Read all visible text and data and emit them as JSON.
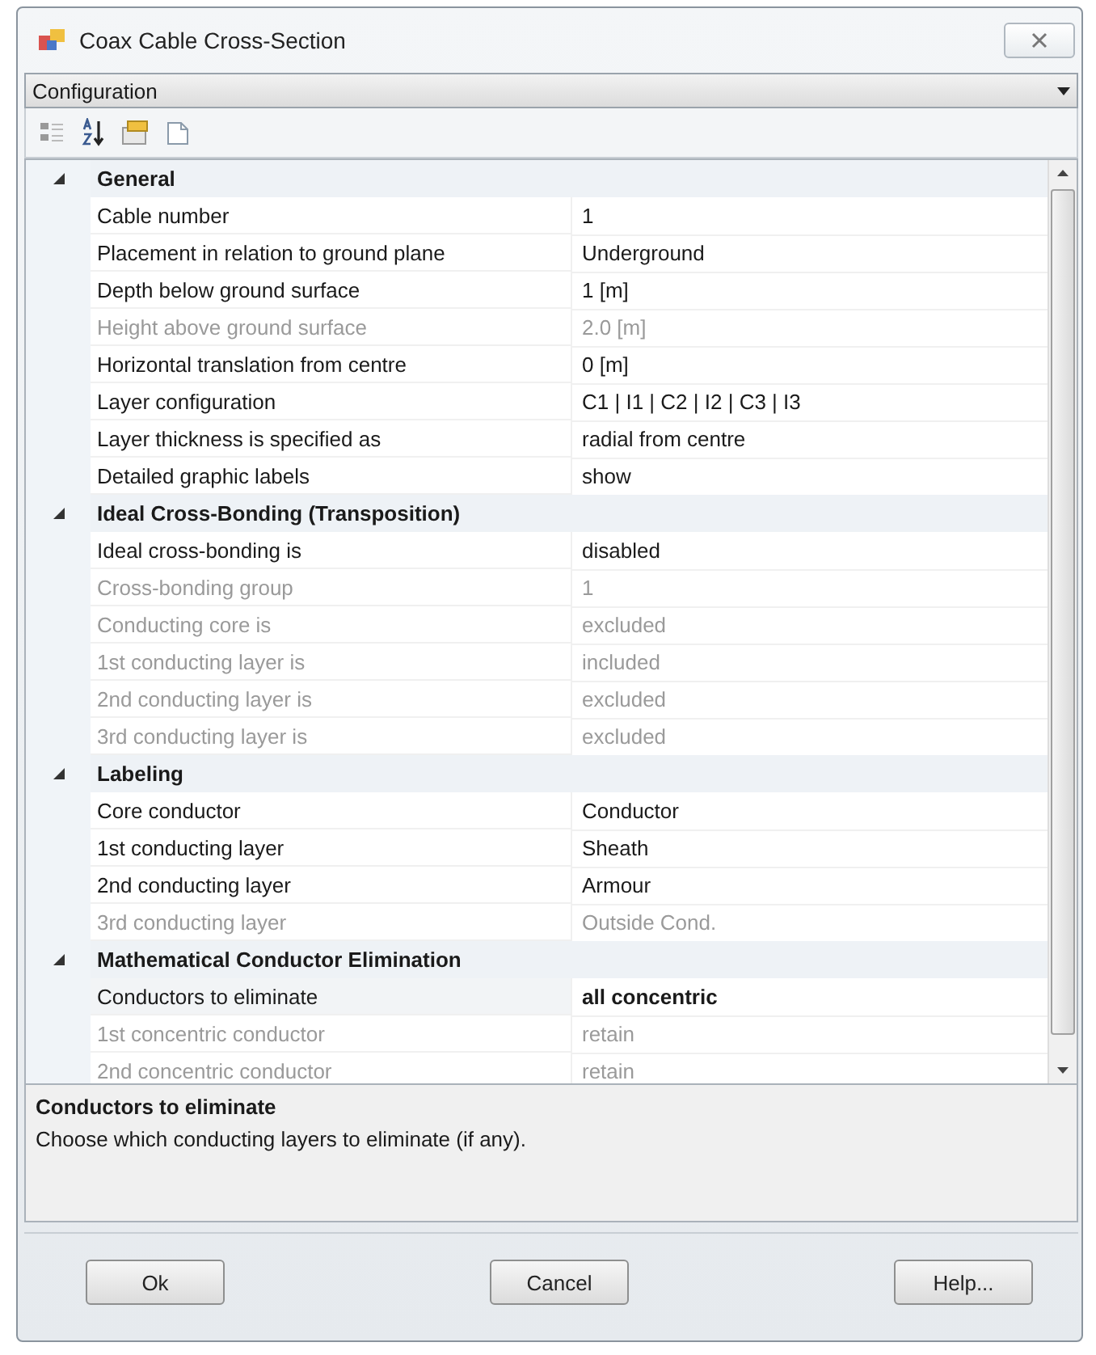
{
  "window": {
    "title": "Coax Cable Cross-Section"
  },
  "object_selector": {
    "value": "Configuration"
  },
  "categories": [
    {
      "name": "General",
      "expanded": true,
      "properties": [
        {
          "name": "Cable number",
          "value": "1",
          "disabled": false,
          "modified": false,
          "selected": false
        },
        {
          "name": "Placement in relation to ground plane",
          "value": "Underground",
          "disabled": false,
          "modified": false,
          "selected": false
        },
        {
          "name": "Depth below ground surface",
          "value": "1 [m]",
          "disabled": false,
          "modified": false,
          "selected": false
        },
        {
          "name": "Height above ground surface",
          "value": "2.0 [m]",
          "disabled": true,
          "modified": false,
          "selected": false
        },
        {
          "name": "Horizontal translation from centre",
          "value": "0 [m]",
          "disabled": false,
          "modified": false,
          "selected": false
        },
        {
          "name": "Layer configuration",
          "value": "C1 | I1 | C2 | I2 | C3 | I3",
          "disabled": false,
          "modified": false,
          "selected": false
        },
        {
          "name": "Layer thickness is specified as",
          "value": "radial from centre",
          "disabled": false,
          "modified": false,
          "selected": false
        },
        {
          "name": "Detailed graphic labels",
          "value": "show",
          "disabled": false,
          "modified": false,
          "selected": false
        }
      ]
    },
    {
      "name": "Ideal Cross-Bonding (Transposition)",
      "expanded": true,
      "properties": [
        {
          "name": "Ideal cross-bonding is",
          "value": "disabled",
          "disabled": false,
          "modified": false,
          "selected": false
        },
        {
          "name": "Cross-bonding group",
          "value": "1",
          "disabled": true,
          "modified": false,
          "selected": false
        },
        {
          "name": "Conducting core is",
          "value": "excluded",
          "disabled": true,
          "modified": false,
          "selected": false
        },
        {
          "name": "1st conducting layer is",
          "value": "included",
          "disabled": true,
          "modified": false,
          "selected": false
        },
        {
          "name": "2nd conducting layer is",
          "value": "excluded",
          "disabled": true,
          "modified": false,
          "selected": false
        },
        {
          "name": "3rd conducting layer is",
          "value": "excluded",
          "disabled": true,
          "modified": false,
          "selected": false
        }
      ]
    },
    {
      "name": "Labeling",
      "expanded": true,
      "properties": [
        {
          "name": "Core conductor",
          "value": "Conductor",
          "disabled": false,
          "modified": false,
          "selected": false
        },
        {
          "name": "1st conducting layer",
          "value": "Sheath",
          "disabled": false,
          "modified": false,
          "selected": false
        },
        {
          "name": "2nd conducting layer",
          "value": "Armour",
          "disabled": false,
          "modified": false,
          "selected": false
        },
        {
          "name": "3rd conducting layer",
          "value": "Outside Cond.",
          "disabled": true,
          "modified": false,
          "selected": false
        }
      ]
    },
    {
      "name": "Mathematical Conductor Elimination",
      "expanded": true,
      "properties": [
        {
          "name": "Conductors to eliminate",
          "value": "all concentric",
          "disabled": false,
          "modified": true,
          "selected": true
        },
        {
          "name": "1st concentric conductor",
          "value": "retain",
          "disabled": true,
          "modified": false,
          "selected": false
        },
        {
          "name": "2nd  concentric conductor",
          "value": "retain",
          "disabled": true,
          "modified": false,
          "selected": false
        }
      ]
    }
  ],
  "description": {
    "title": "Conductors to eliminate",
    "text": "Choose which conducting layers to eliminate (if any)."
  },
  "buttons": [
    {
      "label": "Ok"
    },
    {
      "label": "Cancel"
    },
    {
      "label": "Help..."
    }
  ]
}
